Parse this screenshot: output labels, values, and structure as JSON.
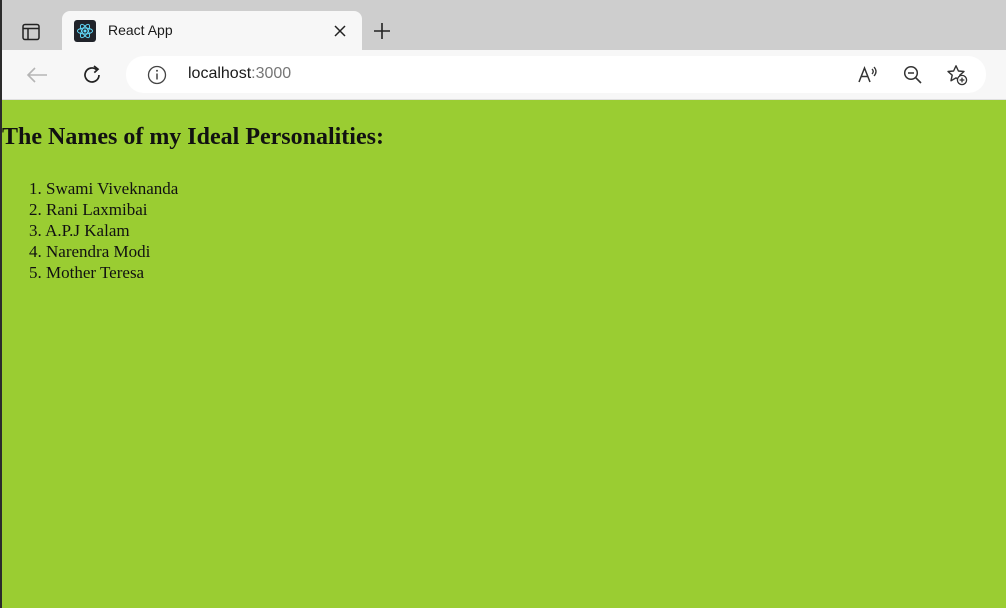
{
  "browser": {
    "tab": {
      "title": "React App"
    },
    "address_bar": {
      "host": "localhost",
      "port": ":3000"
    }
  },
  "page": {
    "background": "#9acd32",
    "heading": "The Names of my Ideal Personalities:",
    "items": [
      {
        "number": "1.",
        "name": "Swami Viveknanda"
      },
      {
        "number": "2.",
        "name": "Rani Laxmibai"
      },
      {
        "number": "3.",
        "name": "A.P.J Kalam"
      },
      {
        "number": "4.",
        "name": "Narendra Modi"
      },
      {
        "number": "5.",
        "name": "Mother Teresa"
      }
    ]
  }
}
